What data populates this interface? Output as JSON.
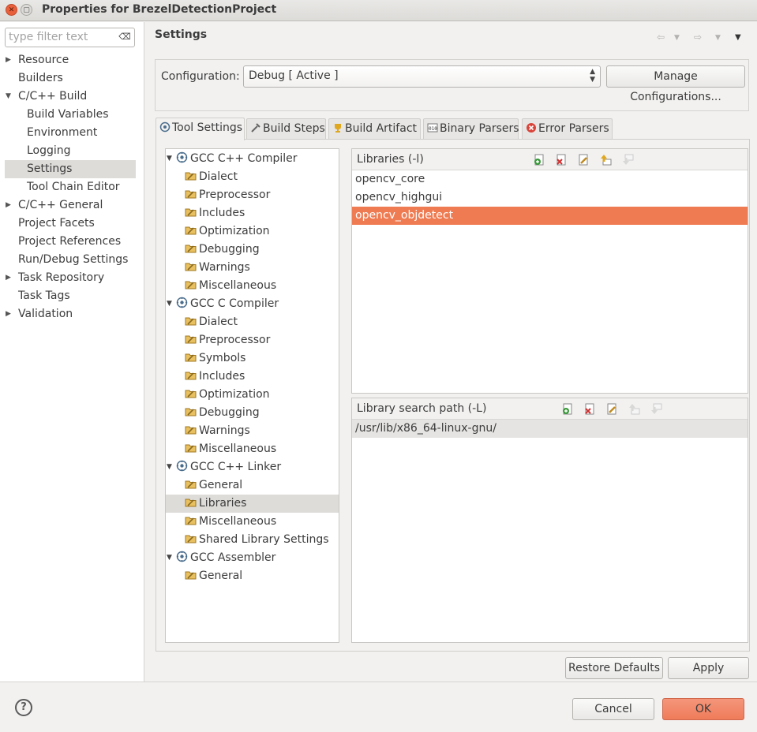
{
  "window": {
    "title": "Properties for BrezelDetectionProject"
  },
  "filter": {
    "placeholder": "type filter text",
    "value": ""
  },
  "nav": {
    "items": [
      {
        "label": "Resource",
        "expandable": true
      },
      {
        "label": "Builders"
      },
      {
        "label": "C/C++ Build",
        "expanded": true
      },
      {
        "label": "Build Variables"
      },
      {
        "label": "Environment"
      },
      {
        "label": "Logging"
      },
      {
        "label": "Settings",
        "selected": true
      },
      {
        "label": "Tool Chain Editor"
      },
      {
        "label": "C/C++ General",
        "expandable": true
      },
      {
        "label": "Project Facets"
      },
      {
        "label": "Project References"
      },
      {
        "label": "Run/Debug Settings"
      },
      {
        "label": "Task Repository",
        "expandable": true
      },
      {
        "label": "Task Tags"
      },
      {
        "label": "Validation",
        "expandable": true
      }
    ]
  },
  "page": {
    "title": "Settings"
  },
  "config": {
    "label": "Configuration:",
    "value": "Debug  [ Active ]",
    "manage_label": "Manage Configurations..."
  },
  "tabs": [
    {
      "label": "Tool Settings",
      "active": true
    },
    {
      "label": "Build Steps"
    },
    {
      "label": "Build Artifact"
    },
    {
      "label": "Binary Parsers"
    },
    {
      "label": "Error Parsers"
    }
  ],
  "tree": {
    "nodes": [
      {
        "label": "GCC C++ Compiler",
        "level": 0
      },
      {
        "label": "Dialect",
        "level": 1
      },
      {
        "label": "Preprocessor",
        "level": 1
      },
      {
        "label": "Includes",
        "level": 1
      },
      {
        "label": "Optimization",
        "level": 1
      },
      {
        "label": "Debugging",
        "level": 1
      },
      {
        "label": "Warnings",
        "level": 1
      },
      {
        "label": "Miscellaneous",
        "level": 1
      },
      {
        "label": "GCC C Compiler",
        "level": 0
      },
      {
        "label": "Dialect",
        "level": 1
      },
      {
        "label": "Preprocessor",
        "level": 1
      },
      {
        "label": "Symbols",
        "level": 1
      },
      {
        "label": "Includes",
        "level": 1
      },
      {
        "label": "Optimization",
        "level": 1
      },
      {
        "label": "Debugging",
        "level": 1
      },
      {
        "label": "Warnings",
        "level": 1
      },
      {
        "label": "Miscellaneous",
        "level": 1
      },
      {
        "label": "GCC C++ Linker",
        "level": 0
      },
      {
        "label": "General",
        "level": 1
      },
      {
        "label": "Libraries",
        "level": 1,
        "selected": true
      },
      {
        "label": "Miscellaneous",
        "level": 1
      },
      {
        "label": "Shared Library Settings",
        "level": 1
      },
      {
        "label": "GCC Assembler",
        "level": 0
      },
      {
        "label": "General",
        "level": 1
      }
    ]
  },
  "libraries": {
    "title": "Libraries (-l)",
    "items": [
      "opencv_core",
      "opencv_highgui",
      "opencv_objdetect"
    ],
    "selected_index": 2
  },
  "search_path": {
    "title": "Library search path (-L)",
    "items": [
      "/usr/lib/x86_64-linux-gnu/"
    ]
  },
  "buttons": {
    "restore": "Restore Defaults",
    "apply": "Apply",
    "cancel": "Cancel",
    "ok": "OK",
    "help": "?"
  },
  "colors": {
    "selection": "#ef7b52",
    "ok_button": "#ef7c5a",
    "close_button": "#e8603c"
  }
}
